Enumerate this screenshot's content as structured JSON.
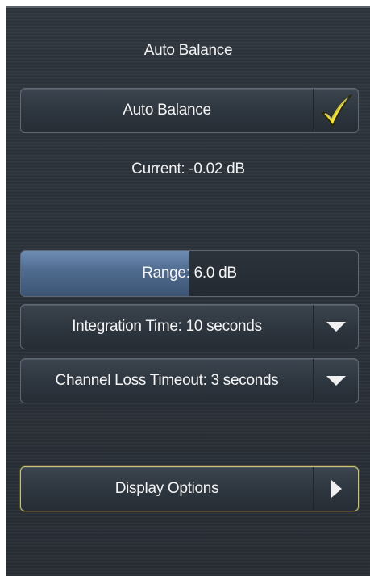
{
  "panel": {
    "title": "Auto Balance"
  },
  "auto_balance": {
    "label": "Auto Balance",
    "checked": true,
    "check_color": "#f5e22a"
  },
  "current": {
    "text": "Current: -0.02 dB"
  },
  "range": {
    "label": "Range: 6.0 dB",
    "level_fraction": 0.5,
    "fill_color": "#5577a0"
  },
  "integration_time": {
    "label": "Integration Time: 10 seconds",
    "icon": "triangle-down-icon"
  },
  "channel_loss_timeout": {
    "label": "Channel Loss Timeout: 3 seconds",
    "icon": "triangle-down-icon"
  },
  "display_options": {
    "label": "Display Options",
    "icon": "triangle-right-icon",
    "highlight_color": "#c9c07a"
  }
}
